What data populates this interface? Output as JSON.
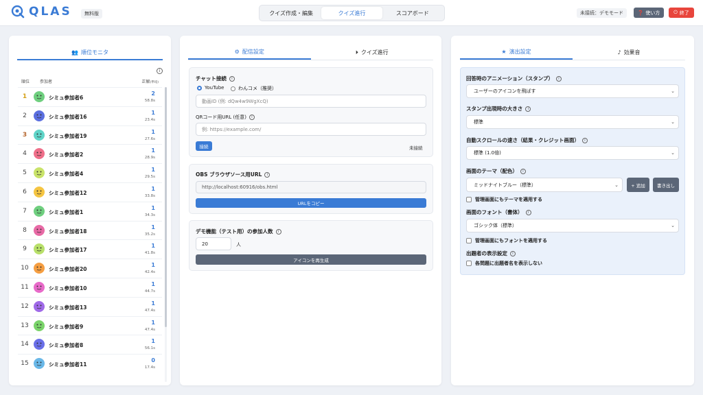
{
  "header": {
    "logo_text": "QLAS",
    "plan_badge": "無料版",
    "nav": [
      "クイズ作成・編集",
      "クイズ進行",
      "スコアボード"
    ],
    "status": "未接続：デモモード",
    "help_label": "使い方",
    "exit_label": "終了"
  },
  "ranking": {
    "tab_label": "順位モニタ",
    "col_rank": "順位",
    "col_name": "参加者",
    "col_score": "正解",
    "col_score_sub": "(平均)",
    "rows": [
      {
        "rank": "1",
        "name": "シミュ参加者6",
        "score": "2",
        "time": "58.8s",
        "color": "#6fcf7f"
      },
      {
        "rank": "2",
        "name": "シミュ参加者16",
        "score": "1",
        "time": "23.4s",
        "color": "#5b6fe0"
      },
      {
        "rank": "3",
        "name": "シミュ参加者19",
        "score": "1",
        "time": "27.6s",
        "color": "#5fd4c8"
      },
      {
        "rank": "4",
        "name": "シミュ参加者2",
        "score": "1",
        "time": "28.9s",
        "color": "#ef6f8a"
      },
      {
        "rank": "5",
        "name": "シミュ参加者4",
        "score": "1",
        "time": "29.5s",
        "color": "#c9e36a"
      },
      {
        "rank": "6",
        "name": "シミュ参加者12",
        "score": "1",
        "time": "33.8s",
        "color": "#f5c542"
      },
      {
        "rank": "7",
        "name": "シミュ参加者1",
        "score": "1",
        "time": "34.3s",
        "color": "#6fcf7f"
      },
      {
        "rank": "8",
        "name": "シミュ参加者18",
        "score": "1",
        "time": "35.2s",
        "color": "#e86aa6"
      },
      {
        "rank": "9",
        "name": "シミュ参加者17",
        "score": "1",
        "time": "41.8s",
        "color": "#b8e06a"
      },
      {
        "rank": "10",
        "name": "シミュ参加者20",
        "score": "1",
        "time": "42.4s",
        "color": "#f59e42"
      },
      {
        "rank": "11",
        "name": "シミュ参加者10",
        "score": "1",
        "time": "44.7s",
        "color": "#e86ac9"
      },
      {
        "rank": "12",
        "name": "シミュ参加者13",
        "score": "1",
        "time": "47.4s",
        "color": "#a06ae8"
      },
      {
        "rank": "13",
        "name": "シミュ参加者9",
        "score": "1",
        "time": "47.4s",
        "color": "#7ad46a"
      },
      {
        "rank": "14",
        "name": "シミュ参加者8",
        "score": "1",
        "time": "56.1s",
        "color": "#6a6fe8"
      },
      {
        "rank": "15",
        "name": "シミュ参加者11",
        "score": "0",
        "time": "17.4s",
        "color": "#6ab8e8"
      }
    ]
  },
  "stream": {
    "tabs": [
      "配信設定",
      "クイズ進行"
    ],
    "chat_label": "チャット接続",
    "radio_youtube": "YouTube",
    "radio_wanko": "わんコメ（推奨）",
    "video_id_placeholder": "動画ID (例: dQw4w9WgXcQ)",
    "qr_label": "QRコード用URL (任意)",
    "qr_placeholder": "例: https://example.com/",
    "connect_btn": "接続",
    "conn_status": "未接続",
    "obs_label": "OBS ブラウザソース用URL",
    "obs_url": "http://localhost:60916/obs.html",
    "copy_btn": "URLをコピー",
    "demo_label": "デモ機能（テスト用）の参加人数",
    "demo_count": "20",
    "demo_unit": "人",
    "regen_btn": "アイコンを再生成"
  },
  "effects": {
    "tabs": [
      "演出設定",
      "効果音"
    ],
    "anim_label": "回答時のアニメーション（スタンプ）",
    "anim_value": "ユーザーのアイコンを飛ばす",
    "stamp_size_label": "スタンプ出現時の大きさ",
    "stamp_size_value": "標準",
    "scroll_label": "自動スクロールの速さ（結果・クレジット画面）",
    "scroll_value": "標準 (1.0倍)",
    "theme_label": "画面のテーマ（配色）",
    "theme_value": "ミッドナイトブルー（標準）",
    "theme_add": "+ 追加",
    "theme_export": "書き出し",
    "theme_apply": "管理画面にもテーマを適用する",
    "font_label": "画面のフォント（書体）",
    "font_value": "ゴシック体（標準）",
    "font_apply": "管理画面にもフォントを適用する",
    "setter_label": "出題者の表示設定",
    "setter_hide": "各問題に出題者名を表示しない"
  }
}
